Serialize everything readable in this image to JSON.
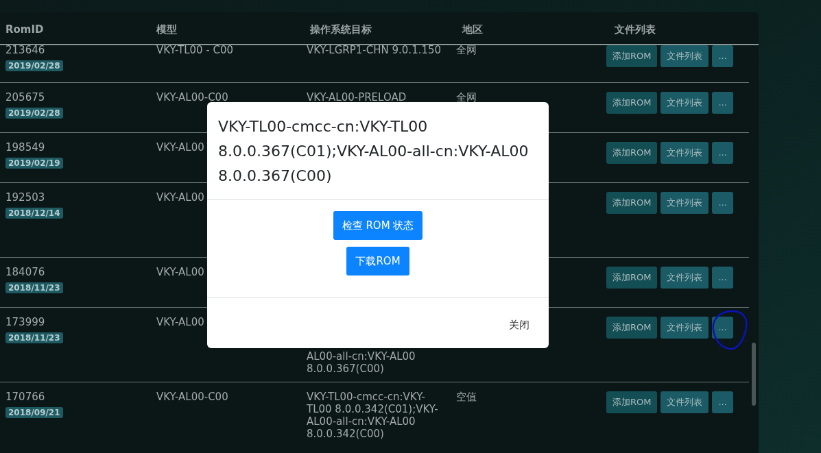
{
  "table": {
    "columns": [
      "RomID",
      "模型",
      "操作系统目标",
      "地区",
      "文件列表"
    ],
    "rows": [
      {
        "rom_id": "213646",
        "date": "2019/02/28",
        "model": "VKY-TL00 - C00",
        "os_target": "VKY-LGRP1-CHN 9.0.1.150",
        "region": "全网",
        "buttons": [
          "添加ROM",
          "文件列表",
          "..."
        ],
        "circled": false
      },
      {
        "rom_id": "205675",
        "date": "2019/02/28",
        "model": "VKY-AL00-C00",
        "os_target": "VKY-AL00-PRELOAD",
        "region": "全网",
        "buttons": [
          "添加ROM",
          "文件列表",
          "..."
        ],
        "circled": false
      },
      {
        "rom_id": "198549",
        "date": "2019/02/19",
        "model": "VKY-AL00",
        "buttons": [
          "添加ROM",
          "文件列表",
          "..."
        ],
        "circled": false
      },
      {
        "rom_id": "192503",
        "date": "2018/12/14",
        "model": "VKY-AL00",
        "buttons": [
          "添加ROM",
          "文件列表",
          "..."
        ],
        "circled": false
      },
      {
        "rom_id": "184076",
        "date": "2018/11/23",
        "model": "VKY-AL00",
        "buttons": [
          "添加ROM",
          "文件列表",
          "..."
        ],
        "circled": false
      },
      {
        "rom_id": "173999",
        "date": "2018/11/23",
        "model": "VKY-AL00",
        "os_target": "AL00-all-cn:VKY-AL00 8.0.0.367(C00)",
        "os_partly_hidden": true,
        "buttons": [
          "添加ROM",
          "文件列表",
          "..."
        ],
        "circled": true
      },
      {
        "rom_id": "170766",
        "date": "2018/09/21",
        "model": "VKY-AL00-C00",
        "os_target": "VKY-TL00-cmcc-cn:VKY-TL00 8.0.0.342(C01);VKY-AL00-all-cn:VKY-AL00 8.0.0.342(C00)",
        "region": "空值",
        "buttons": [
          "添加ROM",
          "文件列表",
          "..."
        ],
        "circled": false
      }
    ]
  },
  "modal": {
    "title": "VKY-TL00-cmcc-cn:VKY-TL00 8.0.0.367(C01);VKY-AL00-all-cn:VKY-AL00 8.0.0.367(C00)",
    "actions": [
      "检查 ROM 状态",
      "下载ROM"
    ],
    "close": "关闭"
  }
}
